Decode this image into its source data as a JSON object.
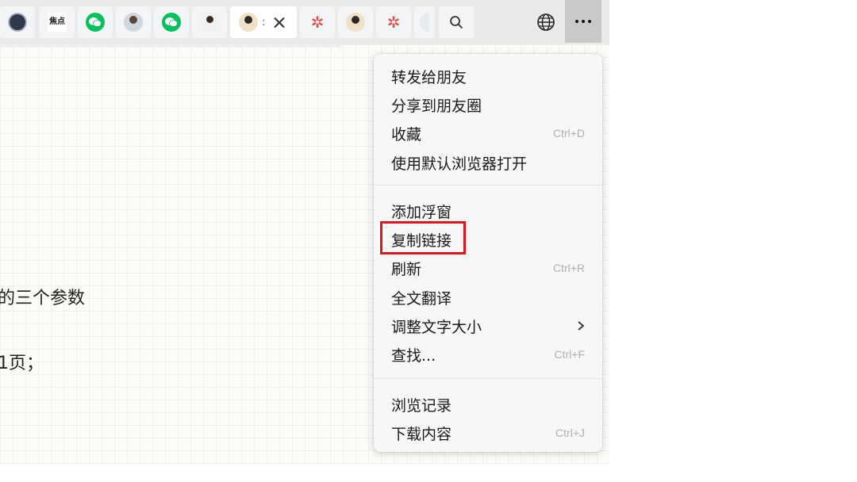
{
  "tabs": [
    {
      "name": "tab-dark-logo",
      "icon": "round-logo-icon"
    },
    {
      "name": "tab-calligraphy",
      "icon": "calligraphy-logo-icon",
      "text": "焦点"
    },
    {
      "name": "tab-wechat-1",
      "icon": "wechat-icon"
    },
    {
      "name": "tab-profile-woman",
      "icon": "avatar-icon"
    },
    {
      "name": "tab-wechat-2",
      "icon": "wechat-icon"
    },
    {
      "name": "tab-profile-suit",
      "icon": "avatar-icon"
    },
    {
      "name": "tab-active",
      "icon": "avatar-icon",
      "active": true
    },
    {
      "name": "tab-star-1",
      "icon": "red-star-logo-icon"
    },
    {
      "name": "tab-photo",
      "icon": "avatar-icon"
    },
    {
      "name": "tab-star-2",
      "icon": "red-star-logo-icon"
    },
    {
      "name": "tab-partial",
      "icon": "partial-icon"
    }
  ],
  "content": {
    "line1": "的三个参数",
    "line2": "1页；"
  },
  "menu": {
    "group1": [
      {
        "label": "转发给朋友",
        "shortcut": ""
      },
      {
        "label": "分享到朋友圈",
        "shortcut": ""
      },
      {
        "label": "收藏",
        "shortcut": "Ctrl+D"
      },
      {
        "label": "使用默认浏览器打开",
        "shortcut": ""
      }
    ],
    "group2": [
      {
        "label": "添加浮窗",
        "shortcut": ""
      },
      {
        "label": "复制链接",
        "shortcut": ""
      },
      {
        "label": "刷新",
        "shortcut": "Ctrl+R"
      },
      {
        "label": "全文翻译",
        "shortcut": ""
      },
      {
        "label": "调整文字大小",
        "shortcut": ""
      },
      {
        "label": "查找...",
        "shortcut": "Ctrl+F"
      }
    ],
    "group3": [
      {
        "label": "浏览记录",
        "shortcut": ""
      },
      {
        "label": "下载内容",
        "shortcut": "Ctrl+J"
      }
    ]
  },
  "colors": {
    "highlight_border": "#e0141c",
    "wechat_green": "#07c160",
    "star_red": "#e8424a"
  }
}
